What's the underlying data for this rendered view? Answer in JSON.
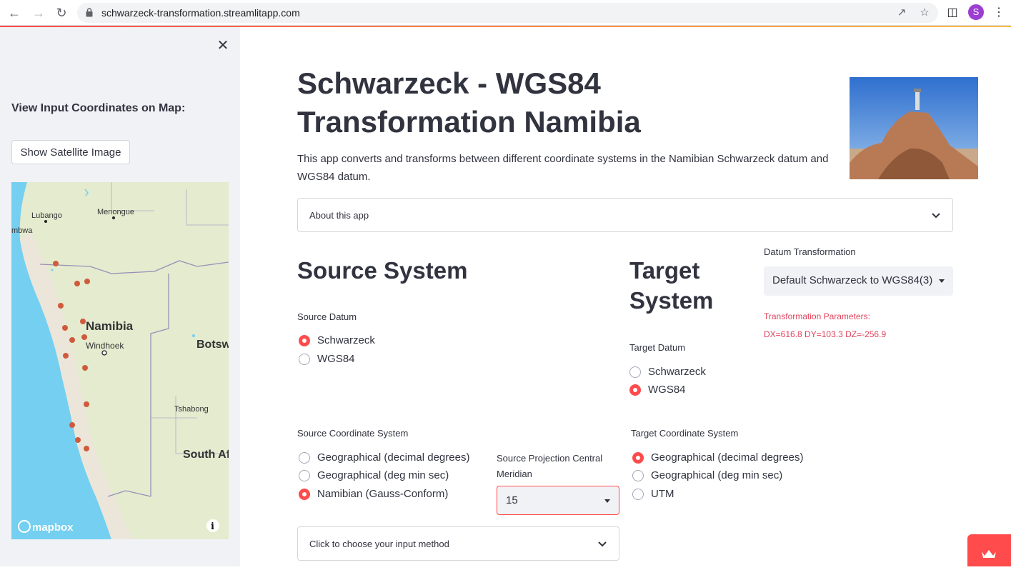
{
  "browser": {
    "url": "schwarzeck-transformation.streamlitapp.com",
    "profile_initial": "S"
  },
  "sidebar": {
    "heading": "View Input Coordinates on Map:",
    "satellite_button": "Show Satellite Image",
    "map": {
      "labels": {
        "lubango": "Lubango",
        "menongue": "Menongue",
        "mbwa": "mbwa",
        "namibia": "Namibia",
        "windhoek": "Windhoek",
        "botswana": "Botsw",
        "tshabong": "Tshabong",
        "south_africa": "South Af"
      },
      "logo": "mapbox",
      "colors": {
        "land": "#e4ebcf",
        "water": "#75cff0",
        "marker": "#d05a3c"
      }
    }
  },
  "main": {
    "title": "Schwarzeck - WGS84 Transformation Namibia",
    "description": "This app converts and transforms between different coordinate systems in the Namibian Schwarzeck datum and WGS84 datum.",
    "about_expander": "About this app",
    "source": {
      "heading": "Source System",
      "datum_label": "Source Datum",
      "datum_options": [
        "Schwarzeck",
        "WGS84"
      ],
      "datum_selected": "Schwarzeck",
      "coord_label": "Source Coordinate System",
      "coord_options": [
        "Geographical (decimal degrees)",
        "Geographical (deg min sec)",
        "Namibian (Gauss-Conform)"
      ],
      "coord_selected": "Namibian (Gauss-Conform)",
      "meridian_label": "Source Projection Central Meridian",
      "meridian_value": "15",
      "input_expander": "Click to choose your input method"
    },
    "target": {
      "heading": "Target System",
      "datum_label": "Target Datum",
      "datum_options": [
        "Schwarzeck",
        "WGS84"
      ],
      "datum_selected": "WGS84",
      "coord_label": "Target Coordinate System",
      "coord_options": [
        "Geographical (decimal degrees)",
        "Geographical (deg min sec)",
        "UTM"
      ],
      "coord_selected": "Geographical (decimal degrees)"
    },
    "datum_transformation": {
      "label": "Datum Transformation",
      "value": "Default Schwarzeck to WGS84(3)",
      "params_title": "Transformation Parameters:",
      "params": "DX=616.8 DY=103.3 DZ=-256.9"
    }
  },
  "colors": {
    "accent": "#ff4b4b",
    "text": "#31333f",
    "param_text": "#e0435c"
  }
}
